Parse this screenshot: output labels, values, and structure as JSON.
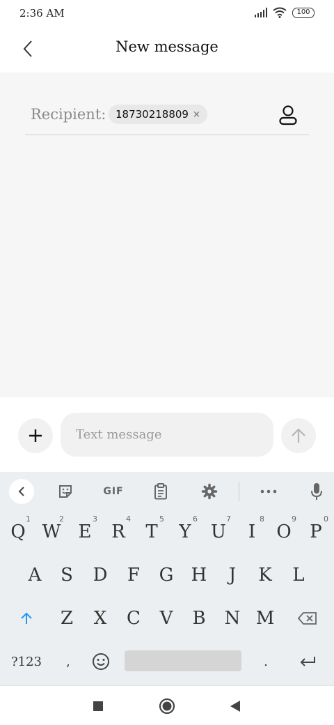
{
  "status_bar": {
    "time": "2:36 AM",
    "battery": "100"
  },
  "header": {
    "title": "New message",
    "back_icon": "chevron-left-icon"
  },
  "recipient": {
    "label": "Recipient:",
    "chip_value": "18730218809",
    "chip_remove": "×"
  },
  "compose": {
    "placeholder": "Text message"
  },
  "keyboard": {
    "toolbar": {
      "gif": "GIF"
    },
    "row1": [
      {
        "key": "Q",
        "hint": "1"
      },
      {
        "key": "W",
        "hint": "2"
      },
      {
        "key": "E",
        "hint": "3"
      },
      {
        "key": "R",
        "hint": "4"
      },
      {
        "key": "T",
        "hint": "5"
      },
      {
        "key": "Y",
        "hint": "6"
      },
      {
        "key": "U",
        "hint": "7"
      },
      {
        "key": "I",
        "hint": "8"
      },
      {
        "key": "O",
        "hint": "9"
      },
      {
        "key": "P",
        "hint": "0"
      }
    ],
    "row2": [
      "A",
      "S",
      "D",
      "F",
      "G",
      "H",
      "J",
      "K",
      "L"
    ],
    "row3": [
      "Z",
      "X",
      "C",
      "V",
      "B",
      "N",
      "M"
    ],
    "symbols_key": "?123",
    "comma_key": ",",
    "period_key": "."
  },
  "colors": {
    "accent": "#2196f3",
    "background": "#f6f6f6",
    "keyboard": "#eceff1"
  }
}
